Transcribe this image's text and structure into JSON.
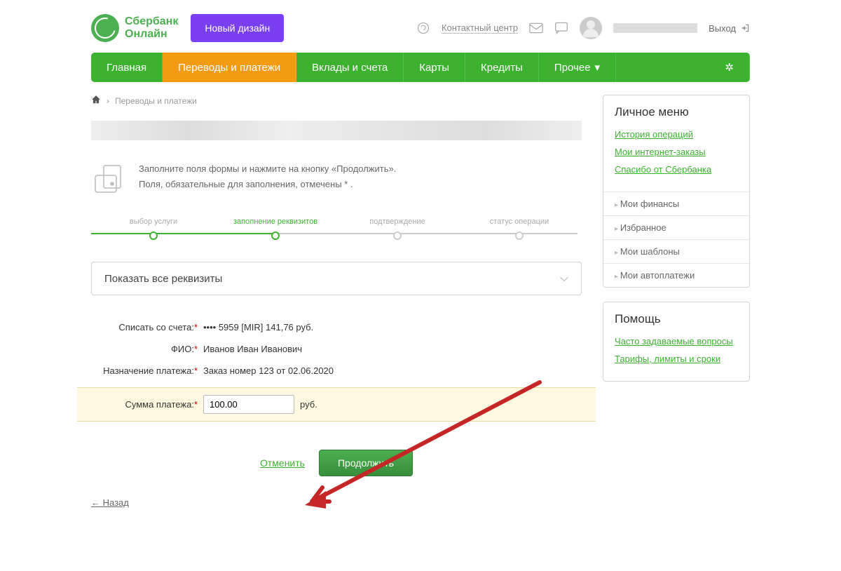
{
  "header": {
    "logo_text1": "Сбербанк",
    "logo_text2": "Онлайн",
    "new_design_btn": "Новый дизайн",
    "contact_center": "Контактный центр",
    "logout": "Выход"
  },
  "nav": {
    "main": "Главная",
    "transfers": "Переводы и платежи",
    "deposits": "Вклады и счета",
    "cards": "Карты",
    "credits": "Кредиты",
    "other": "Прочее"
  },
  "breadcrumb": "Переводы и платежи",
  "intro": {
    "line1": "Заполните поля формы и нажмите на кнопку «Продолжить».",
    "line2": "Поля, обязательные для заполнения, отмечены * ."
  },
  "steps": {
    "s1": "выбор услуги",
    "s2": "заполнение реквизитов",
    "s3": "подтверждение",
    "s4": "статус операции"
  },
  "accordion": "Показать все реквизиты",
  "form": {
    "account_label": "Списать со счета:",
    "account_value": "•••• 5959  [MIR] 141,76   руб.",
    "fio_label": "ФИО:",
    "fio_value": "Иванов Иван Иванович",
    "purpose_label": "Назначение платежа:",
    "purpose_value": "Заказ номер 123 от 02.06.2020",
    "amount_label": "Сумма платежа:",
    "amount_value": "100.00",
    "amount_unit": "руб."
  },
  "actions": {
    "cancel": "Отменить",
    "continue": "Продолжить",
    "back": "Назад"
  },
  "sidebar": {
    "menu_title": "Личное меню",
    "history": "История операций",
    "orders": "Мои интернет-заказы",
    "thanks": "Спасибо от Сбербанка",
    "finances": "Мои финансы",
    "favorites": "Избранное",
    "templates": "Мои шаблоны",
    "autopay": "Мои автоплатежи",
    "help_title": "Помощь",
    "faq": "Часто задаваемые вопросы",
    "tariffs": "Тарифы, лимиты и сроки"
  }
}
